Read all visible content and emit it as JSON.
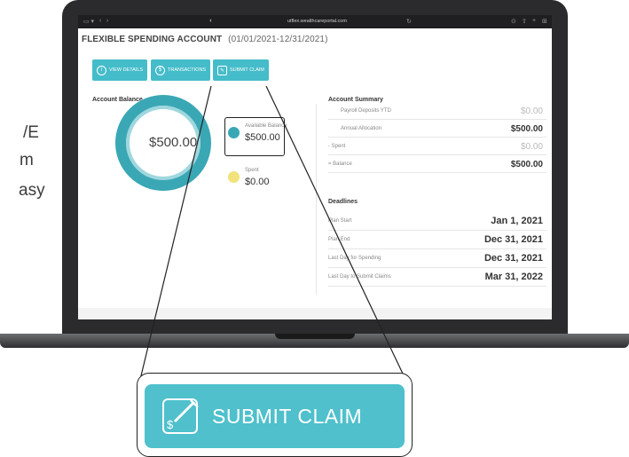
{
  "side_text": [
    "/E",
    "m",
    "asy"
  ],
  "browser": {
    "url": "utflex.wealthcareportal.com"
  },
  "page": {
    "title": "FLEXIBLE SPENDING ACCOUNT",
    "date_range": "(01/01/2021-12/31/2021)"
  },
  "buttons": {
    "view_details": "VIEW DETAILS",
    "transactions": "TRANSACTIONS",
    "submit_claim": "SUBMIT CLAIM"
  },
  "account_balance": {
    "heading": "Account Balance",
    "center_value": "$500.00",
    "available_label": "Available Balance",
    "available_value": "$500.00",
    "spent_label": "Spent",
    "spent_value": "$0.00"
  },
  "account_summary": {
    "heading": "Account Summary",
    "rows": [
      {
        "label": "Payroll Deposits YTD",
        "value": "$0.00"
      },
      {
        "label": "Annual Allocation",
        "value": "$500.00"
      },
      {
        "label": "-  Spent",
        "value": "$0.00"
      },
      {
        "label": "=  Balance",
        "value": "$500.00"
      }
    ]
  },
  "deadlines": {
    "heading": "Deadlines",
    "rows": [
      {
        "label": "Plan Start",
        "value": "Jan 1, 2021"
      },
      {
        "label": "Plan End",
        "value": "Dec 31, 2021"
      },
      {
        "label": "Last Day for Spending",
        "value": "Dec 31, 2021"
      },
      {
        "label": "Last Day to Submit Claims",
        "value": "Mar 31, 2022"
      }
    ]
  },
  "callout": {
    "label": "SUBMIT CLAIM"
  },
  "colors": {
    "accent": "#45bcc9",
    "donut": "#3aa7b5",
    "spent_dot": "#f1e27a",
    "laptop": "#2b2b2d"
  }
}
